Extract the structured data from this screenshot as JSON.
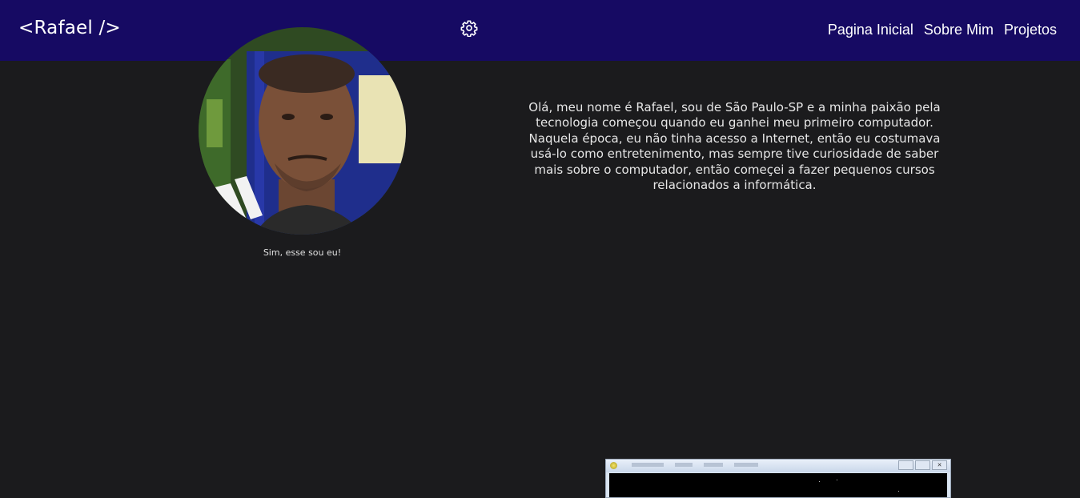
{
  "header": {
    "brand": "<Rafael />",
    "settings_icon": "gear-icon",
    "nav": [
      {
        "label": "Pagina Inicial"
      },
      {
        "label": "Sobre Mim"
      },
      {
        "label": "Projetos"
      }
    ]
  },
  "about": {
    "photo_caption": "Sim, esse sou eu!",
    "bio": "Olá, meu nome é Rafael, sou de São Paulo-SP e a minha paixão pela tecnologia começou quando eu ganhei meu primeiro computador. Naquela época, eu não tinha acesso a Internet, então eu costumava usá-lo como entretenimento, mas sempre tive curiosidade de saber mais sobre o computador, então começei a fazer pequenos cursos relacionados a informática."
  },
  "colors": {
    "navbar": "#160a63",
    "background": "#1b1b1d",
    "text": "#e6e6e6"
  }
}
